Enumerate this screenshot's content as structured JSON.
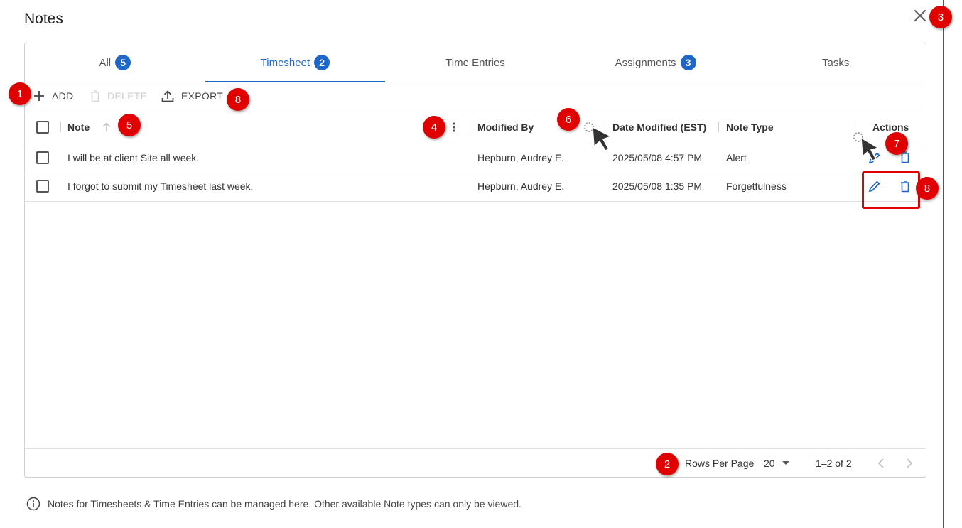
{
  "dialog": {
    "title": "Notes"
  },
  "tabs": [
    {
      "label": "All",
      "count": "5"
    },
    {
      "label": "Timesheet",
      "count": "2"
    },
    {
      "label": "Time Entries",
      "count": ""
    },
    {
      "label": "Assignments",
      "count": "3"
    },
    {
      "label": "Tasks",
      "count": ""
    }
  ],
  "toolbar": {
    "add_label": "ADD",
    "delete_label": "DELETE",
    "export_label": "EXPORT"
  },
  "grid": {
    "headers": {
      "note": "Note",
      "modified_by": "Modified By",
      "date_modified": "Date Modified (EST)",
      "note_type": "Note Type",
      "actions": "Actions"
    },
    "rows": [
      {
        "note": "I will be at client Site all week.",
        "modified_by": "Hepburn, Audrey E.",
        "date_modified": "2025/05/08 4:57 PM",
        "note_type": "Alert"
      },
      {
        "note": "I forgot to submit my Timesheet last week.",
        "modified_by": "Hepburn, Audrey E.",
        "date_modified": "2025/05/08 1:35 PM",
        "note_type": "Forgetfulness"
      }
    ]
  },
  "pagination": {
    "rows_per_page_label": "Rows Per Page",
    "rows_per_page_value": "20",
    "range": "1–2 of 2"
  },
  "info_text": "Notes for Timesheets & Time Entries can be managed here. Other available Note types can only be viewed.",
  "annotations": [
    "1",
    "2",
    "3",
    "4",
    "5",
    "6",
    "7",
    "8",
    "8"
  ],
  "colors": {
    "accent": "#1e66c8",
    "annotation": "#e10000"
  },
  "icons": [
    "close-icon",
    "plus-icon",
    "trash-icon",
    "upload-icon",
    "sort-up-arrow-icon",
    "kebab-menu-icon",
    "pencil-icon",
    "chevron-down-icon",
    "chevron-left-icon",
    "chevron-right-icon",
    "info-icon",
    "mouse-pointer-icon"
  ]
}
